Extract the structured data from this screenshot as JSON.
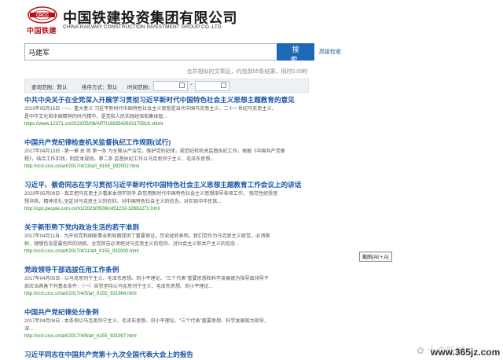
{
  "header": {
    "title_cn": "中国铁建投资集团有限公司",
    "title_en": "CHINA RAILWAY CONSTRUCTION INVESTMENT GROUP CO.,LTD.",
    "logo_caption": "中国铁建",
    "logo_text": "CRCC",
    "brand_color": "#b3141b"
  },
  "search": {
    "value": "马建军",
    "button_label": "搜 索",
    "advanced_label": "高级检索",
    "button_color": "#1f68b6"
  },
  "result_info": "合并相似的文章后，约找到55条结果，用时0.09秒",
  "filters": {
    "scope_label": "查询范围：默认",
    "sort_label": "排序方式：默认",
    "time_label": "时间范围："
  },
  "results": [
    {
      "title": "中共中央关于在全党深入开展学习贯彻习近平新时代中国特色社会主义思想主题教育的意见",
      "snippet": [
        "2023年05月15日 - 一、重大意义 习近平新时代中国特色社会主义思想是当代中国马克思主义、二十一世纪马克思主义，",
        "是中华文化和中国精神的时代精华，是党和人民实践经验和集体智..."
      ],
      "url": "https://www.12371.cn/2023/05/08/ARTI1683542603175916.shtml"
    },
    {
      "title": "中国共产党纪律检查机关监督执纪工作规则(试行)",
      "snippet": [
        "2017年04月13日 - 第一章 总 则 第一条 为全面从严治党，维护党的纪律，规范纪检机关监督执纪工作，根据《中国共产党章",
        "程》，结合工作实践，制定本规则。第二条 监督执纪工作以马克思列宁主义、毛泽东思想..."
      ],
      "url": "http://crcl.crcc.cn/art/2017/4/13/art_6155_932002.html"
    },
    {
      "title": "习近平、蔡奇同志在学习贯彻习近平新时代中国特色社会主义思想主题教育工作会议上的讲话",
      "snippet": [
        "2023年05月09日 - 真正把马克思主义看家本领学到手,自觉用新时代中国特色社会主义思想指导各项工作。 强党性经受思",
        "想淬炼、精神洗礼,坚定对马克思主义的信仰、对中国特色社会主义的信念、对实现中华民族..."
      ],
      "url": "http://cpc.people.com.cn/n1/2023/0508/c451232-32681272.html"
    },
    {
      "title": "关于新形势下党内政治生活的若干准则",
      "snippet": [
        "2017年04月11日 - 为开创党和国家事业新局面提供了重要保证。历史经验表明，我们党作为马克思主义政党，必须旗",
        "帜，理想信念是最危险的动摇。全党同志必须把对马克思主义的信仰、对社会主义和共产主义的信念..."
      ],
      "url": "http://crcl.crcc.cn/art/2017/4/11/art_6155_932000.html"
    },
    {
      "title": "党政领导干部选拔任用工作条例",
      "snippet": [
        "2017年04月05日 - 以马克思列宁主义、毛泽东思想、邓小平理论、\"三个代表\"重要思想和科学发展观为指导政领导干",
        "部应当具备下列基本条件：（一）自觉坚持以马克思列宁主义、毛泽东思想、邓小平理论..."
      ],
      "url": "http://crcl.crcc.cn/art/2017/4/5/art_6155_931964.html"
    },
    {
      "title": "中国共产党纪律处分条例",
      "snippet": [
        "2017年04月08日 - 本条例以马克思列宁主义、毛泽东思想、邓小平理论、\"三个代表\"重要思想、科学发展观为指导，",
        "深..."
      ],
      "url": "http://crcl.crcc.cn/art/2017/4/8/art_6155_931997.html"
    },
    {
      "title": "习近平同志在中国共产党第十九次全国代表大会上的报告",
      "snippet": [],
      "url": ""
    }
  ],
  "tooltip": "截图(Alt + A)",
  "watermark": {
    "text": "✿ 十个新闻",
    "site": "www.365jz.com"
  }
}
